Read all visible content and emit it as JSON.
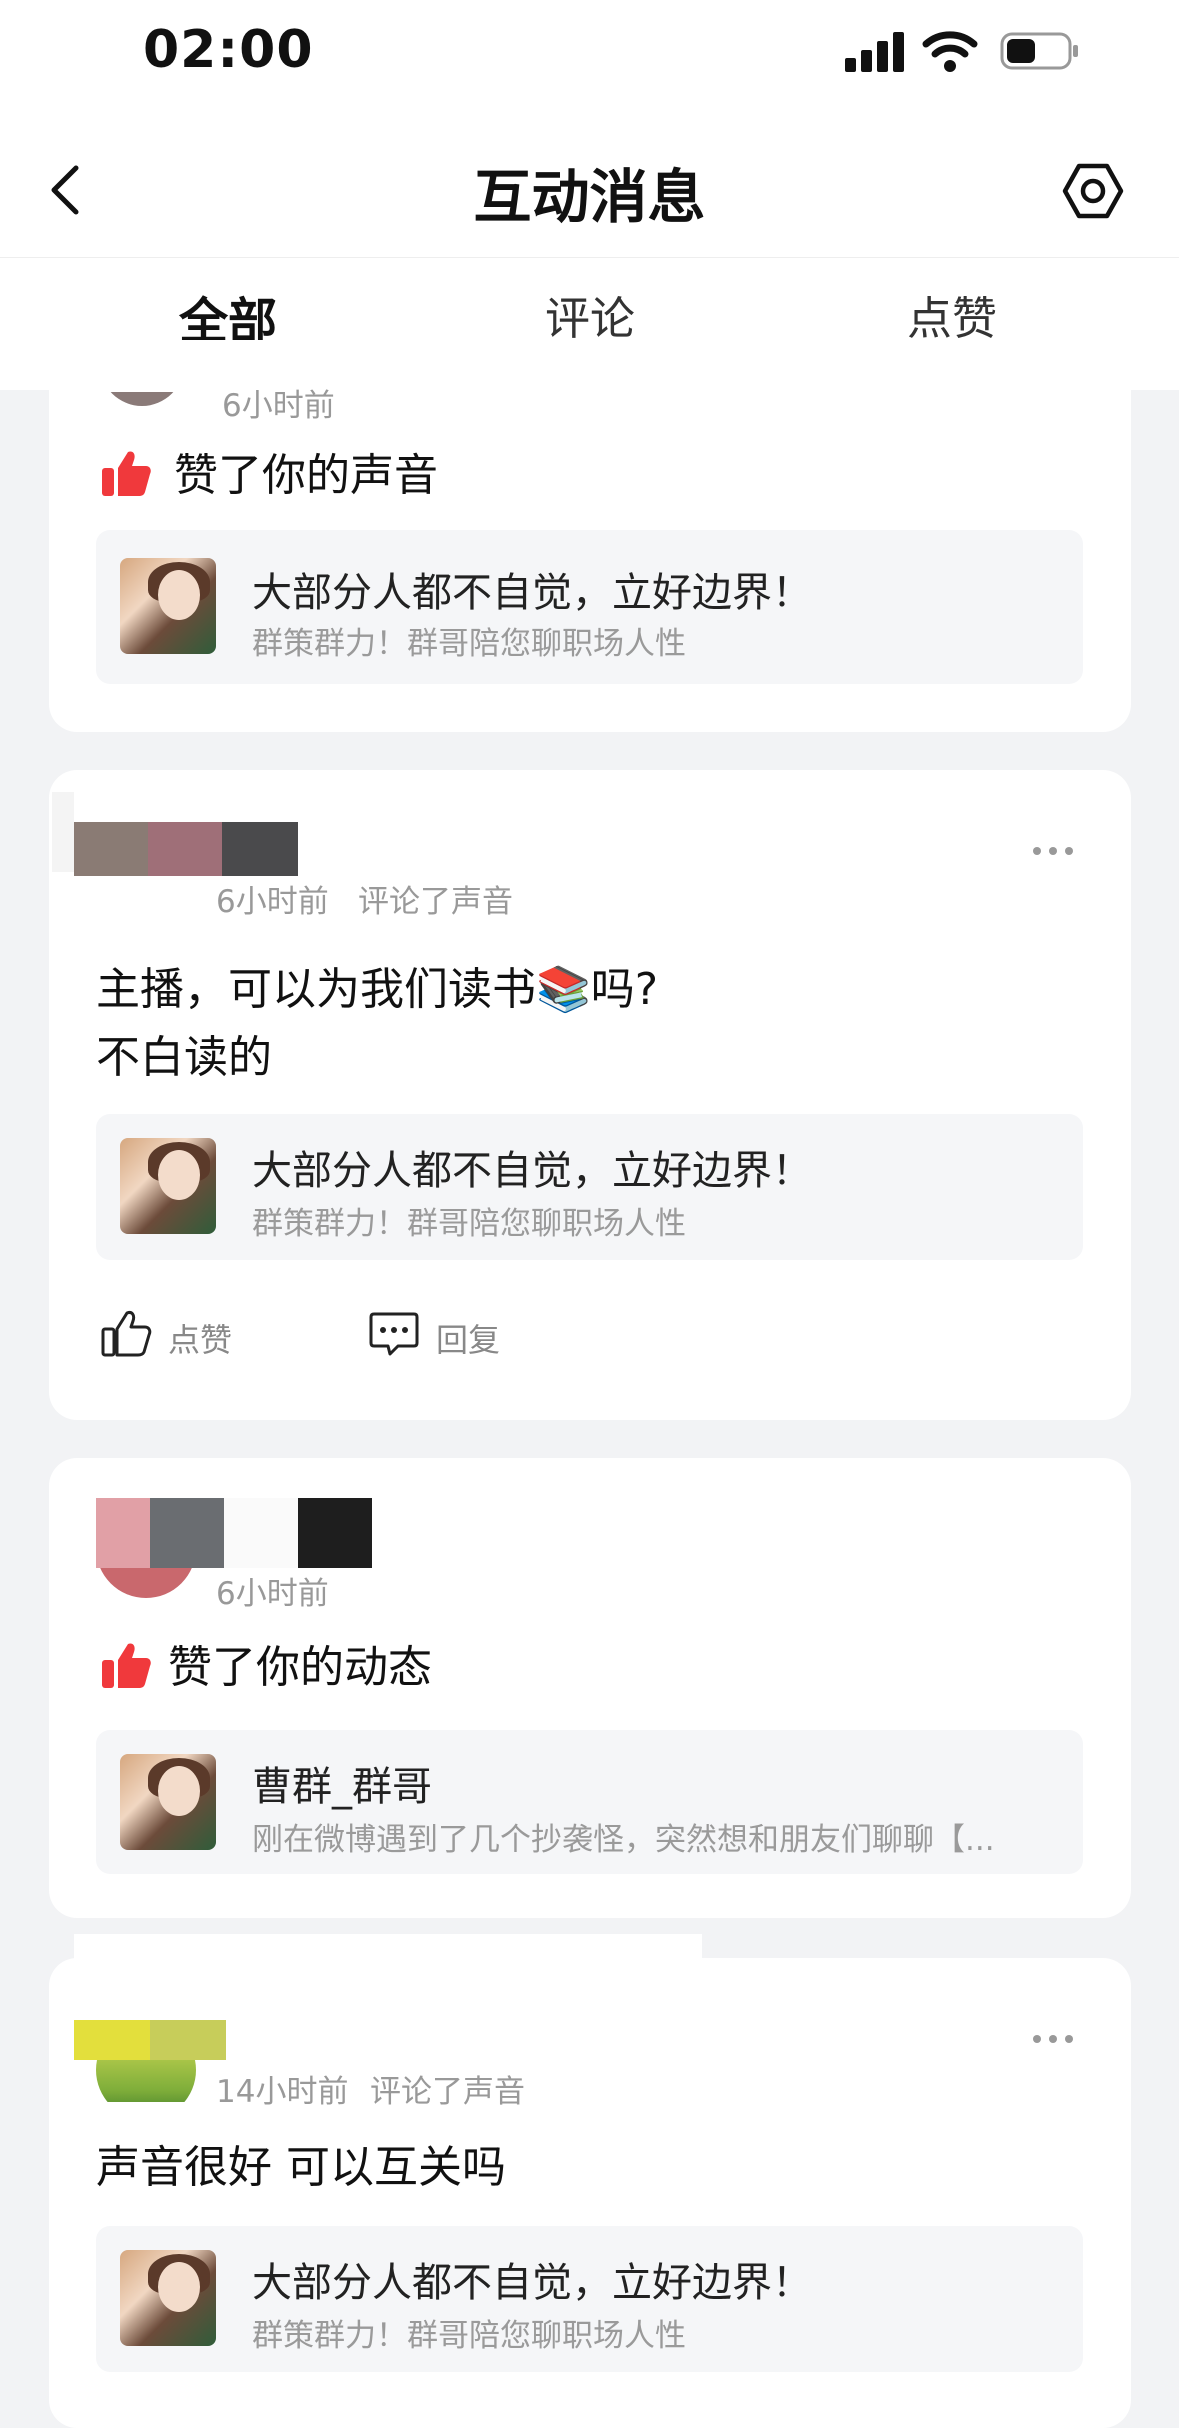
{
  "status_bar": {
    "time": "02:00"
  },
  "header": {
    "title": "互动消息"
  },
  "tabs": [
    {
      "label": "全部",
      "active": true
    },
    {
      "label": "评论",
      "active": false
    },
    {
      "label": "点赞",
      "active": false
    }
  ],
  "colors": {
    "accent": "#f0393c",
    "background": "#f2f3f5"
  },
  "notifications": [
    {
      "time": "6小时前",
      "action": "",
      "text": "赞了你的声音",
      "quote": {
        "title": "大部分人都不自觉，立好边界！",
        "subtitle": "群策群力！群哥陪您聊职场人性"
      }
    },
    {
      "time": "6小时前",
      "action": "评论了声音",
      "text_line1": "主播，可以为我们读书",
      "emoji": "📚",
      "text_line1_end": "吗?",
      "text_line2": "不白读的",
      "quote": {
        "title": "大部分人都不自觉，立好边界！",
        "subtitle": "群策群力！群哥陪您聊职场人性"
      },
      "actions": {
        "like": "点赞",
        "reply": "回复"
      }
    },
    {
      "time": "6小时前",
      "action": "",
      "text": "赞了你的动态",
      "quote": {
        "title": "曹群_群哥",
        "subtitle": "刚在微博遇到了几个抄袭怪，突然想和朋友们聊聊【..."
      }
    },
    {
      "time": "14小时前",
      "action": "评论了声音",
      "text": "声音很好 可以互关吗",
      "quote": {
        "title": "大部分人都不自觉，立好边界！",
        "subtitle": "群策群力！群哥陪您聊职场人性"
      }
    }
  ]
}
